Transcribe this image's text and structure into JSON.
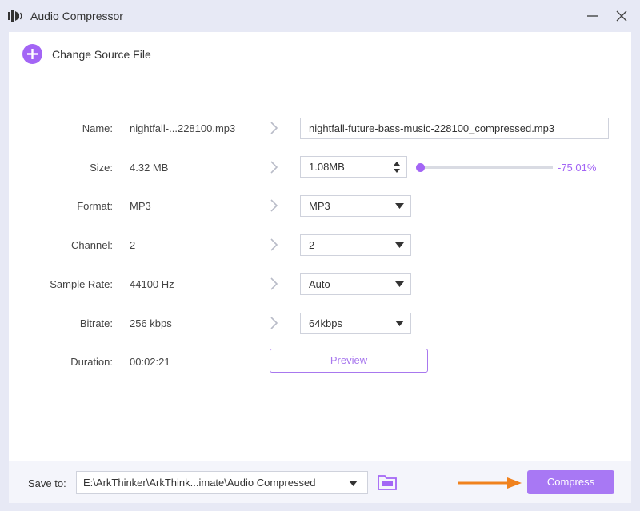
{
  "window": {
    "title": "Audio Compressor",
    "icons": {
      "app": "speaker-icon",
      "minimize": "minimize-icon",
      "close": "close-icon"
    }
  },
  "source": {
    "label": "Change Source File",
    "icon": "plus-icon"
  },
  "fields": {
    "name": {
      "label": "Name:",
      "original": "nightfall-...228100.mp3",
      "output": "nightfall-future-bass-music-228100_compressed.mp3"
    },
    "size": {
      "label": "Size:",
      "original": "4.32 MB",
      "output": "1.08MB",
      "percent": "-75.01%",
      "slider_fraction": 0.0
    },
    "format": {
      "label": "Format:",
      "original": "MP3",
      "selected": "MP3"
    },
    "channel": {
      "label": "Channel:",
      "original": "2",
      "selected": "2"
    },
    "sample_rate": {
      "label": "Sample Rate:",
      "original": "44100 Hz",
      "selected": "Auto"
    },
    "bitrate": {
      "label": "Bitrate:",
      "original": "256 kbps",
      "selected": "64kbps"
    },
    "duration": {
      "label": "Duration:",
      "original": "00:02:21"
    }
  },
  "preview_label": "Preview",
  "footer": {
    "save_label": "Save to:",
    "save_path": "E:\\ArkThinker\\ArkThink...imate\\Audio Compressed",
    "compress_label": "Compress",
    "icons": {
      "folder": "folder-icon",
      "arrow": "arrow-right-icon"
    }
  },
  "colors": {
    "accent": "#a365f5",
    "button": "#a878f4",
    "arrow": "#f0821e",
    "background": "#e7e9f5"
  }
}
